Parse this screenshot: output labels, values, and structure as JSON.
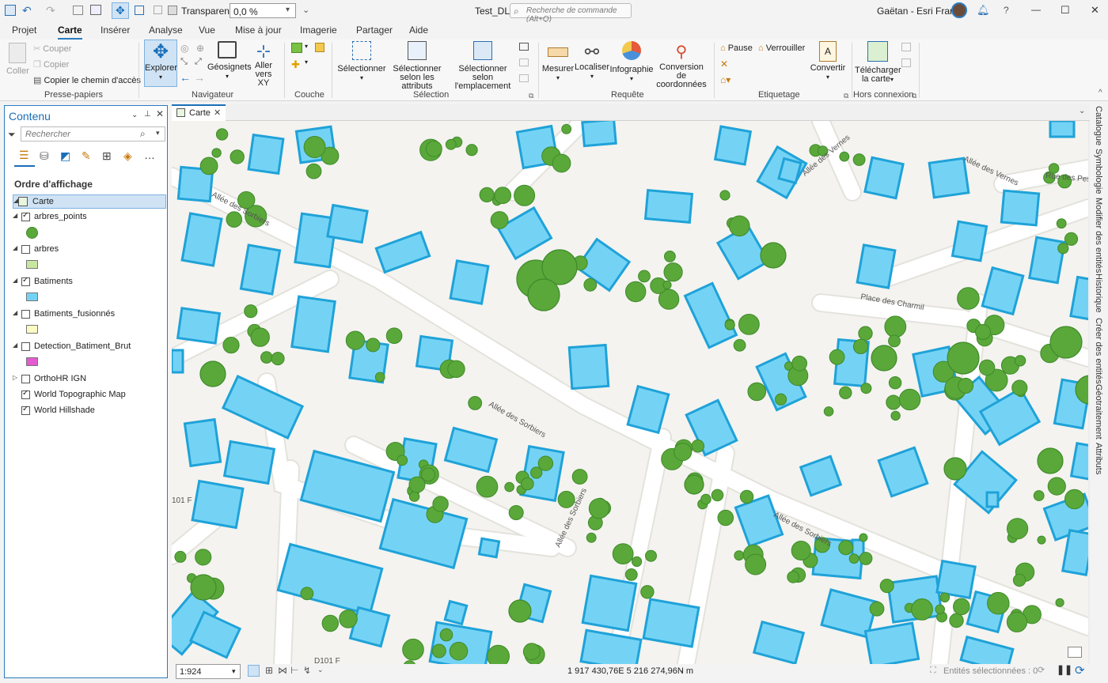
{
  "titlebar": {
    "transparency_label": "Transparence",
    "transparency_value": "0,0 %",
    "project_name": "Test_DL",
    "command_search_placeholder": "Recherche de commande (Alt+Q)",
    "user_name": "Gaëtan - Esri France",
    "help_glyph": "?",
    "minimize_glyph": "—",
    "maximize_glyph": "☐",
    "close_glyph": "✕"
  },
  "menu": {
    "tabs": [
      "Projet",
      "Carte",
      "Insérer",
      "Analyse",
      "Vue",
      "Mise à jour",
      "Imagerie",
      "Partager",
      "Aide"
    ],
    "active": "Carte"
  },
  "ribbon": {
    "clipboard": {
      "paste": "Coller",
      "cut": "Couper",
      "copy": "Copier",
      "copy_path": "Copier le chemin d'accès",
      "group": "Presse-papiers"
    },
    "navigate": {
      "explore": "Explorer",
      "bookmarks": "Géosignets",
      "goto_xy_1": "Aller",
      "goto_xy_2": "vers XY",
      "group": "Navigateur"
    },
    "layer": {
      "group": "Couche"
    },
    "selection": {
      "select": "Sélectionner",
      "by_attr_1": "Sélectionner",
      "by_attr_2": "selon les attributs",
      "by_loc_1": "Sélectionner selon",
      "by_loc_2": "l'emplacement",
      "group": "Sélection"
    },
    "inquiry": {
      "measure": "Mesurer",
      "locate": "Localiser",
      "infographics": "Infographie",
      "convert_coords_1": "Conversion de",
      "convert_coords_2": "coordonnées",
      "group": "Requête"
    },
    "labeling": {
      "pause": "Pause",
      "lock": "Verrouiller",
      "convert": "Convertir",
      "group": "Etiquetage"
    },
    "offline": {
      "download_1": "Télécharger",
      "download_2": "la carte",
      "group": "Hors connexion"
    }
  },
  "contents": {
    "title": "Contenu",
    "search_placeholder": "Rechercher",
    "draw_order_title": "Ordre d'affichage",
    "map_name": "Carte",
    "layers": [
      {
        "name": "arbres_points",
        "checked": true,
        "swatch": "#5aa83a",
        "swatch_shape": "circle"
      },
      {
        "name": "arbres",
        "checked": false,
        "swatch": "#c8e6a0",
        "swatch_shape": "rect"
      },
      {
        "name": "Batiments",
        "checked": true,
        "swatch": "#74d3f5",
        "swatch_shape": "rect"
      },
      {
        "name": "Batiments_fusionnés",
        "checked": false,
        "swatch": "#fbfbc4",
        "swatch_shape": "rect"
      },
      {
        "name": "Detection_Batiment_Brut",
        "checked": false,
        "swatch": "#e45ad0",
        "swatch_shape": "rect"
      },
      {
        "name": "OrthoHR IGN",
        "checked": false,
        "swatch": null,
        "swatch_shape": null
      },
      {
        "name": "World Topographic Map",
        "checked": true,
        "swatch": null,
        "swatch_shape": null
      },
      {
        "name": "World Hillshade",
        "checked": true,
        "swatch": null,
        "swatch_shape": null
      }
    ]
  },
  "map_view": {
    "tab_label": "Carte",
    "street_labels": [
      "Allée des Sorbiers",
      "Allée des Sorbiers",
      "Allée des Sorbiers",
      "Allée des Sorbiers",
      "Allée des Vernes",
      "Allée des Vernes",
      "Rue des Pess",
      "Place des Charmil",
      "101 F",
      "D101 F"
    ],
    "colors": {
      "building_fill": "#74d3f5",
      "building_stroke": "#1fa2d8",
      "tree_fill": "#5aa83a",
      "tree_dark": "#3f8a2a",
      "road": "#ffffff",
      "background": "#f4f3ef"
    }
  },
  "right_tabs": [
    "Catalogue",
    "Symbologie",
    "Modifier des entités",
    "Historique",
    "Créer des entités",
    "Géotraitement",
    "Attributs"
  ],
  "status": {
    "scale": "1:924",
    "coordinates": "1 917 430,76E 5 216 274,96N m",
    "selected_features": "Entités sélectionnées : 0"
  }
}
